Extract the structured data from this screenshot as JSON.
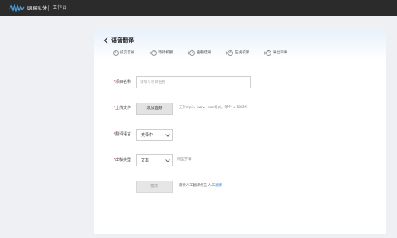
{
  "topbar": {
    "brand": "网易见外",
    "workbench": "工作台"
  },
  "page": {
    "title": "语音翻译"
  },
  "steps": [
    {
      "num": "1",
      "label": "提交音视"
    },
    {
      "num": "2",
      "label": "等待机翻"
    },
    {
      "num": "3",
      "label": "查看结果"
    },
    {
      "num": "4",
      "label": "在线校译"
    },
    {
      "num": "5",
      "label": "导出字幕"
    }
  ],
  "form": {
    "project_name": {
      "label": "项目名称",
      "placeholder": "请填写项目名称"
    },
    "upload": {
      "label": "上传文件",
      "button": "添加音频",
      "hint": "支持mp3、wav、aac格式，单个 ≤ 500M"
    },
    "language": {
      "label": "翻译语言",
      "value": "英译中"
    },
    "output": {
      "label": "出稿类型",
      "value": "文本",
      "hint": "附型字幕"
    },
    "submit": {
      "label": "提交"
    },
    "tip": {
      "text": "需要人工翻译点击 ",
      "link": "人工翻译"
    }
  },
  "colors": {
    "topbar": "#2b2b2b",
    "accent": "#2d7be0",
    "required": "#e04040",
    "background": "#eef0f3"
  }
}
